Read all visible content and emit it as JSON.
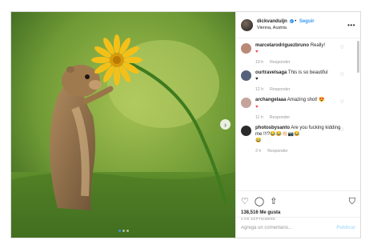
{
  "post": {
    "username": "dickvanduijn",
    "verified_icon": "verified-badge-icon",
    "follow_label": "Seguir",
    "separator": "•",
    "location": "Vienna, Austria",
    "more_label": "•••"
  },
  "comments": [
    {
      "user": "marcelarodriguezbruno",
      "text": "Really!",
      "line2": "♥",
      "time": "19 h",
      "reply": "Responder",
      "avatar_color": "#b98b76"
    },
    {
      "user": "ourtravelsaga",
      "text": "This is so beautiful",
      "line2": "♥",
      "time": "12 h",
      "reply": "Responder",
      "avatar_color": "#55637a"
    },
    {
      "user": "archangelaaa",
      "text": "Amazing shot! 😍",
      "line2": "♥",
      "time": "11 h",
      "reply": "Responder",
      "avatar_color": "#c4a49a"
    },
    {
      "user": "photosbysanto",
      "text": "Are you fucking kidding me !!!?😂😂👏🏻📷😂",
      "line2": "😂",
      "time": "3 h",
      "reply": "Responder",
      "avatar_color": "#2a2a2a"
    }
  ],
  "actions": {
    "like_icon": "heart-outline-icon",
    "comment_icon": "comment-icon",
    "share_icon": "share-icon",
    "save_icon": "bookmark-icon",
    "likes_text": "138,516 Me gusta",
    "date_text": "4 DE SEPTIEMBRE"
  },
  "add_comment": {
    "placeholder": "Agrega un comentario...",
    "post_label": "Publicar"
  },
  "carousel": {
    "next_icon": "chevron-right-icon",
    "dot_count": 3,
    "active_dot": 0
  }
}
